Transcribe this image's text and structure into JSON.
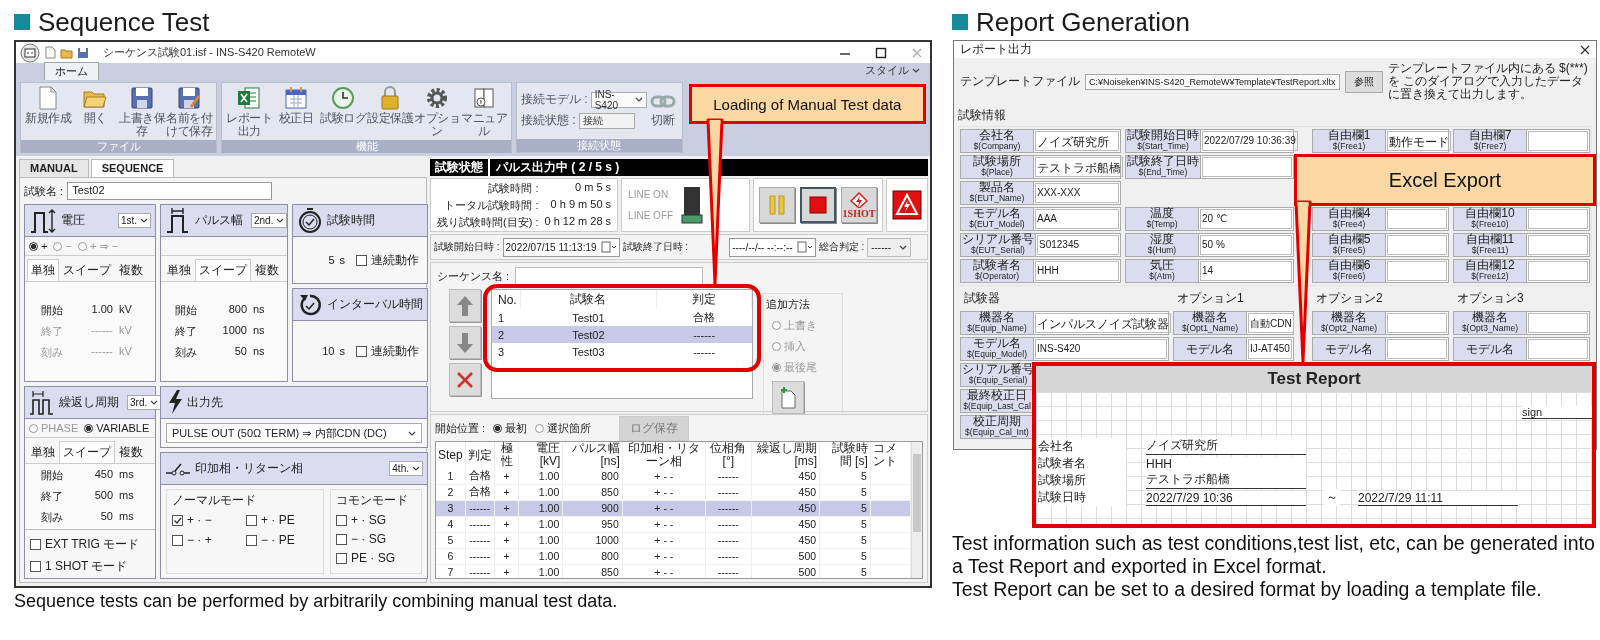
{
  "sequence_section": {
    "heading": "Sequence Test",
    "window": {
      "title": "シーケンス試験01.isf - INS-S420 RemoteW",
      "ribbon_tabs": [
        {
          "label": "ホーム",
          "selected": true
        }
      ],
      "style_menu": "スタイル",
      "ribbon_groups": [
        {
          "label": "ファイル",
          "buttons": [
            "新規作成",
            "開く",
            "上書き保存",
            "名前を付けて保存"
          ]
        },
        {
          "label": "機能",
          "buttons": [
            "レポート出力",
            "校正日",
            "試験ログ",
            "設定保護",
            "オプション",
            "マニュアル"
          ]
        },
        {
          "label": "接続状態",
          "fields": [
            {
              "label": "接続モデル :",
              "value": "INS-S420",
              "kind": "select"
            },
            {
              "label": "接続状態 :",
              "value": "接続",
              "kind": "text"
            }
          ],
          "action": "切断"
        }
      ],
      "mode_tabs": [
        {
          "label": "MANUAL",
          "selected": false
        },
        {
          "label": "SEQUENCE",
          "selected": true
        }
      ],
      "test_name": {
        "label": "試験名 :",
        "value": "Test02"
      },
      "cards": [
        {
          "kind": "param",
          "title": "電圧",
          "order": "1st.",
          "options": [
            {
              "label": "+",
              "selected": true
            },
            {
              "label": "−",
              "selected": false
            },
            {
              "label": "+ ⇒ −",
              "selected": false
            }
          ],
          "tabs": [
            {
              "label": "単独",
              "selected": true
            },
            {
              "label": "スイープ",
              "selected": false
            },
            {
              "label": "複数",
              "selected": false
            }
          ],
          "rows": [
            {
              "label": "開始",
              "value": "1.00",
              "unit": "kV",
              "disabled": false
            },
            {
              "label": "終了",
              "value": "------",
              "unit": "kV",
              "disabled": true
            },
            {
              "label": "刻み",
              "value": "------",
              "unit": "kV",
              "disabled": true
            }
          ]
        },
        {
          "kind": "param",
          "title": "パルス幅",
          "order": "2nd.",
          "tabs": [
            {
              "label": "単独",
              "selected": false
            },
            {
              "label": "スイープ",
              "selected": true
            },
            {
              "label": "複数",
              "selected": false
            }
          ],
          "rows": [
            {
              "label": "開始",
              "value": "800",
              "unit": "ns",
              "disabled": false
            },
            {
              "label": "終了",
              "value": "1000",
              "unit": "ns",
              "disabled": false
            },
            {
              "label": "刻み",
              "value": "50",
              "unit": "ns",
              "disabled": false
            }
          ]
        },
        {
          "kind": "time",
          "title": "試験時間",
          "value": "5",
          "unit": "s",
          "check": {
            "label": "連続動作",
            "checked": false
          }
        },
        {
          "kind": "time",
          "title": "インターバル時間",
          "value": "10",
          "unit": "s",
          "check": {
            "label": "連続動作",
            "checked": false
          }
        },
        {
          "kind": "param",
          "title": "繰返し周期",
          "order": "3rd.",
          "options": [
            {
              "label": "PHASE",
              "selected": false
            },
            {
              "label": "VARIABLE",
              "selected": true
            }
          ],
          "tabs": [
            {
              "label": "単独",
              "selected": false
            },
            {
              "label": "スイープ",
              "selected": true
            },
            {
              "label": "複数",
              "selected": false
            }
          ],
          "rows": [
            {
              "label": "開始",
              "value": "450",
              "unit": "ms",
              "disabled": false
            },
            {
              "label": "終了",
              "value": "500",
              "unit": "ms",
              "disabled": false
            },
            {
              "label": "刻み",
              "value": "50",
              "unit": "ms",
              "disabled": false
            }
          ],
          "checks": [
            {
              "label": "EXT TRIG モード",
              "checked": false
            },
            {
              "label": "1 SHOT モード",
              "checked": false
            }
          ]
        },
        {
          "kind": "output",
          "title": "出力先",
          "value": "PULSE OUT (50Ω TERM) ⇒ 内部CDN (DC)"
        },
        {
          "kind": "phase",
          "title": "印加相・リターン相",
          "order": "4th.",
          "groups": [
            {
              "title": "ノーマルモード",
              "items": [
                {
                  "label": "+ · −",
                  "checked": true
                },
                {
                  "label": "+ · PE",
                  "checked": false
                },
                {
                  "label": "− · +",
                  "checked": false
                },
                {
                  "label": "− · PE",
                  "checked": false
                }
              ]
            },
            {
              "title": "コモンモード",
              "items": [
                {
                  "label": "+ · SG",
                  "checked": false
                },
                {
                  "label": "− · SG",
                  "checked": false
                },
                {
                  "label": "PE · SG",
                  "checked": false
                }
              ]
            }
          ]
        }
      ],
      "status": {
        "label": "試験状態",
        "value": "パルス出力中 ( 2 / 5 s )"
      },
      "timers": [
        {
          "label": "試験時間 :",
          "value": "0 m 5 s"
        },
        {
          "label": "トータル試験時間 :",
          "value": "0 h 9 m 50 s"
        },
        {
          "label": "残り試験時間(目安) :",
          "value": "0 h 12 m 28 s"
        }
      ],
      "line": {
        "on_label": "LINE ON",
        "off_label": "LINE OFF"
      },
      "oneshot_label": "1SHOT",
      "dates": [
        {
          "label": "試験開始日時 :",
          "value": "2022/07/15 11:13:19"
        },
        {
          "label": "試験終了日時 :",
          "value": "----/--/-- --:--:--"
        }
      ],
      "judgement": {
        "label": "総合判定 :",
        "value": "------"
      },
      "sequence": {
        "label": "シーケンス名 :",
        "columns": [
          "No.",
          "試験名",
          "判定"
        ],
        "rows": [
          {
            "cells": [
              "1",
              "Test01",
              "合格"
            ],
            "selected": false
          },
          {
            "cells": [
              "2",
              "Test02",
              "------"
            ],
            "selected": true
          },
          {
            "cells": [
              "3",
              "Test03",
              "------"
            ],
            "selected": false
          }
        ]
      },
      "add_method": {
        "title": "追加方法",
        "options": [
          {
            "label": "上書き",
            "selected": false
          },
          {
            "label": "挿入",
            "selected": false
          },
          {
            "label": "最後尾",
            "selected": true
          }
        ]
      },
      "start_position": {
        "label": "開始位置 :",
        "options": [
          {
            "label": "最初",
            "selected": true
          },
          {
            "label": "選択箇所",
            "selected": false
          }
        ],
        "log_button": "ログ保存"
      },
      "steps": {
        "columns": [
          "Step",
          "判定",
          "極性",
          "電圧 [kV]",
          "パルス幅 [ns]",
          "印加相・リターン相",
          "位相角 [°]",
          "繰返し周期 [ms]",
          "試験時間 [s]",
          "コメント"
        ],
        "rows": [
          {
            "cells": [
              "1",
              "合格",
              "+",
              "1.00",
              "800",
              "+ - -",
              "------",
              "450",
              "5"
            ],
            "selected": false
          },
          {
            "cells": [
              "2",
              "合格",
              "+",
              "1.00",
              "850",
              "+ - -",
              "------",
              "450",
              "5"
            ],
            "selected": false
          },
          {
            "cells": [
              "3",
              "------",
              "+",
              "1.00",
              "900",
              "+ - -",
              "------",
              "450",
              "5"
            ],
            "selected": true
          },
          {
            "cells": [
              "4",
              "------",
              "+",
              "1.00",
              "950",
              "+ - -",
              "------",
              "450",
              "5"
            ],
            "selected": false
          },
          {
            "cells": [
              "5",
              "------",
              "+",
              "1.00",
              "1000",
              "+ - -",
              "------",
              "450",
              "5"
            ],
            "selected": false
          },
          {
            "cells": [
              "6",
              "------",
              "+",
              "1.00",
              "800",
              "+ - -",
              "------",
              "500",
              "5"
            ],
            "selected": false
          },
          {
            "cells": [
              "7",
              "------",
              "+",
              "1.00",
              "850",
              "+ - -",
              "------",
              "500",
              "5"
            ],
            "selected": false
          }
        ]
      }
    },
    "callout": "Loading of Manual Test data",
    "caption": "Sequence tests can be performed by arbitrarily combining manual test data."
  },
  "report_section": {
    "heading": "Report Generation",
    "dialog": {
      "title": "レポート出力",
      "template": {
        "label": "テンプレートファイル",
        "value": "C:¥Noiseken¥INS-S420_RemoteW¥Template¥TestReport.xltx",
        "button": "参照",
        "note": "テンプレートファイル内にある $(***) を このダイアログで入力したデータに置き換えて出力します。"
      },
      "test_info": {
        "title": "試験情報",
        "columns": [
          [
            {
              "name": "会社名",
              "key": "$(Company)",
              "value": "ノイズ研究所"
            },
            {
              "name": "試験場所",
              "key": "$(Place)",
              "value": "テストラボ船橋"
            },
            {
              "name": "製品名",
              "key": "$(EUT_Name)",
              "value": "XXX-XXX"
            },
            {
              "name": "モデル名",
              "key": "$(EUT_Model)",
              "value": "AAA"
            },
            {
              "name": "シリアル番号",
              "key": "$(EUT_Serial)",
              "value": "S012345"
            },
            {
              "name": "試験者名",
              "key": "$(Operator)",
              "value": "HHH"
            }
          ],
          [
            {
              "name": "試験開始日時",
              "key": "$(Start_Time)",
              "value": "2022/07/29 10:36:39"
            },
            {
              "name": "試験終了日時",
              "key": "$(End_Time)"
            },
            {
              "kind": "blank"
            },
            {
              "name": "温度",
              "key": "$(Temp)",
              "value": "20 ℃"
            },
            {
              "name": "湿度",
              "key": "$(Hum)",
              "value": "50 %"
            },
            {
              "name": "気圧",
              "key": "$(Atm)",
              "value": "14"
            }
          ],
          [
            {
              "name": "自由欄1",
              "key": "$(Free1)",
              "value": "動作モード"
            },
            {
              "kind": "blank"
            },
            {
              "kind": "blank"
            },
            {
              "name": "自由欄4",
              "key": "$(Free4)"
            },
            {
              "name": "自由欄5",
              "key": "$(Free5)"
            },
            {
              "name": "自由欄6",
              "key": "$(Free6)"
            }
          ],
          [
            {
              "name": "自由欄7",
              "key": "$(Free7)"
            },
            {
              "kind": "blank"
            },
            {
              "kind": "blank"
            },
            {
              "name": "自由欄10",
              "key": "$(Free10)"
            },
            {
              "name": "自由欄11",
              "key": "$(Free11)"
            },
            {
              "name": "自由欄12",
              "key": "$(Free12)"
            }
          ]
        ]
      },
      "equipment": [
        {
          "title": "試験器",
          "items": [
            {
              "name": "機器名",
              "key": "$(Equip_Name)",
              "value": "インパルスノイズ試験器"
            },
            {
              "name": "モデル名",
              "key": "$(Equip_Model)",
              "value": "INS-S420"
            },
            {
              "name": "シリアル番号",
              "key": "$(Equip_Serial)"
            },
            {
              "name": "最終校正日",
              "key": "$(Equip_Last_Cal"
            },
            {
              "name": "校正周期",
              "key": "$(Equip_Cal_Int)"
            }
          ]
        },
        {
          "title": "オプション1",
          "items": [
            {
              "name": "機器名",
              "key": "$(Opt1_Name)",
              "value": "自動CDN"
            },
            {
              "name": "モデル名",
              "value": "IJ-AT450"
            }
          ]
        },
        {
          "title": "オプション2",
          "items": [
            {
              "name": "機器名",
              "key": "$(Opt2_Name)"
            },
            {
              "name": "モデル名"
            }
          ]
        },
        {
          "title": "オプション3",
          "items": [
            {
              "name": "機器名",
              "key": "$(Opt3_Name)"
            },
            {
              "name": "モデル名"
            }
          ]
        }
      ]
    },
    "callout": "Excel Export",
    "report": {
      "title": "Test Report",
      "sign": "sign",
      "rows": [
        {
          "label": "会社名",
          "value": "ノイズ研究所"
        },
        {
          "label": "試験者名",
          "value": "HHH"
        },
        {
          "label": "試験場所",
          "value": "テストラボ船橋"
        },
        {
          "label": "試験日時",
          "value": "2022/7/29 10:36",
          "separator": "～",
          "end_value": "2022/7/29 11:11"
        }
      ]
    },
    "captions": [
      "Test information such as test conditions,test list, etc, can be generated into a Test Report and exported in Excel format.",
      "Test Report can be set to a desired format by loading a template file."
    ]
  }
}
